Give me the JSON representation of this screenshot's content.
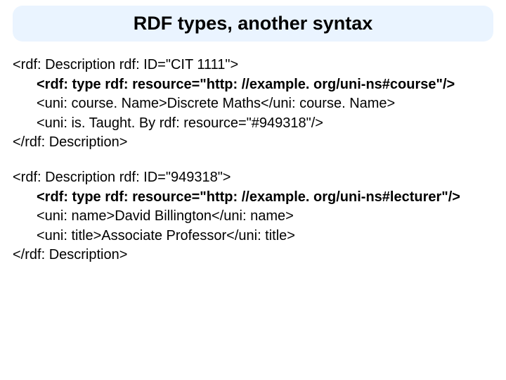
{
  "title": "RDF types, another syntax",
  "block1": {
    "line1": "<rdf: Description rdf: ID=\"CIT 1111\">",
    "line2": "<rdf: type rdf: resource=\"http: //example. org/uni-ns#course\"/>",
    "line3": "<uni: course. Name>Discrete Maths</uni: course. Name>",
    "line4": "<uni: is. Taught. By rdf: resource=\"#949318\"/>",
    "line5": "</rdf: Description>"
  },
  "block2": {
    "line1": "<rdf: Description rdf: ID=\"949318\">",
    "line2": "<rdf: type rdf: resource=\"http: //example. org/uni-ns#lecturer\"/>",
    "line3": "<uni: name>David Billington</uni: name>",
    "line4": "<uni: title>Associate Professor</uni: title>",
    "line5": "</rdf: Description>"
  }
}
